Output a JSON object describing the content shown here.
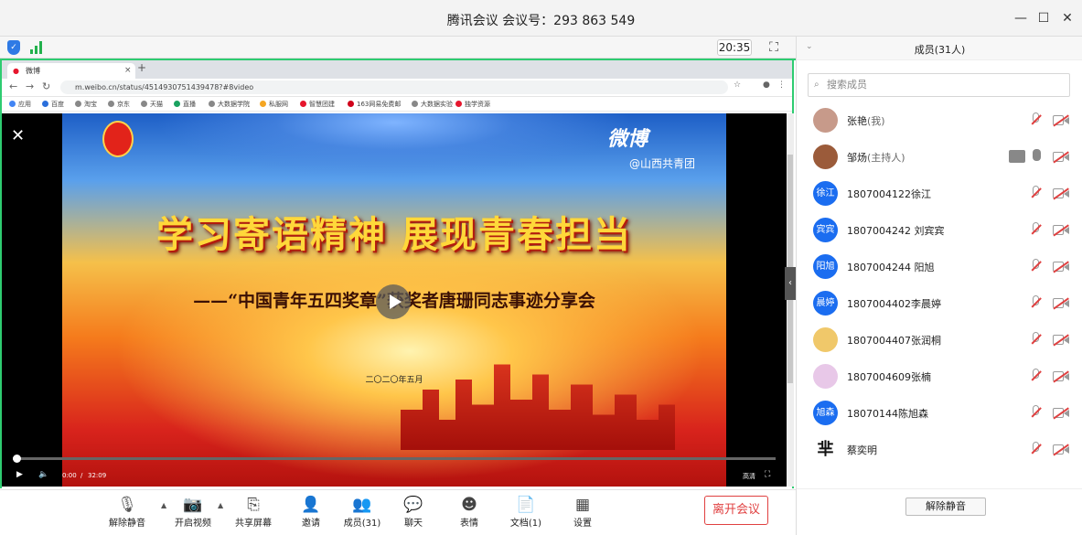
{
  "window": {
    "title": "腾讯会议 会议号：293 863 549",
    "minimize": "—",
    "maximize": "☐",
    "close": "✕"
  },
  "topbar": {
    "clock": "20:35",
    "fullscreen_icon": "fullscreen-icon"
  },
  "browser": {
    "tab_title": "微博",
    "tab_close": "×",
    "new_tab": "+",
    "url": "m.weibo.cn/status/4514930751439478?#8video",
    "bookmarks": [
      "应用",
      "百度",
      "淘宝",
      "京东",
      "天猫",
      "直播",
      "大数据学院",
      "私服网",
      "智慧团建",
      "163网易免费邮",
      "大数据实验",
      "独学资源"
    ]
  },
  "video": {
    "poster_title": "学习寄语精神  展现青春担当",
    "poster_subtitle": "——“中国青年五四奖章”获奖者唐珊同志事迹分享会",
    "poster_date": "二〇二〇年五月",
    "weibo_logo": "微博",
    "weibo_account": "@山西共青团",
    "current_time": "0:00",
    "duration": "32:09",
    "quality": "高清",
    "progress": 0.0
  },
  "toolbar": {
    "items": [
      {
        "label": "解除静音",
        "icon": "mic-muted-icon"
      },
      {
        "label": "开启视频",
        "icon": "camera-off-icon"
      },
      {
        "label": "共享屏幕",
        "icon": "share-screen-icon"
      },
      {
        "label": "邀请",
        "icon": "invite-icon"
      },
      {
        "label": "成员(31)",
        "icon": "members-icon"
      },
      {
        "label": "聊天",
        "icon": "chat-icon"
      },
      {
        "label": "表情",
        "icon": "emoji-icon"
      },
      {
        "label": "文档(1)",
        "icon": "document-icon"
      },
      {
        "label": "设置",
        "icon": "settings-icon"
      }
    ],
    "leave_label": "离开会议"
  },
  "panel": {
    "title": "成员(31人)",
    "search_placeholder": "搜索成员",
    "members": [
      {
        "name": "张艳",
        "role": "(我)",
        "avatar": ""
      },
      {
        "name": "邹炀",
        "role": "(主持人)",
        "avatar": ""
      },
      {
        "name": "1807004122徐江",
        "role": "",
        "avatar": "徐江"
      },
      {
        "name": "1807004242  刘宾宾",
        "role": "",
        "avatar": "宾宾"
      },
      {
        "name": "1807004244 阳旭",
        "role": "",
        "avatar": "阳旭"
      },
      {
        "name": "1807004402李晨婷",
        "role": "",
        "avatar": "晨婷"
      },
      {
        "name": "1807004407张润桐",
        "role": "",
        "avatar": ""
      },
      {
        "name": "1807004609张楠",
        "role": "",
        "avatar": ""
      },
      {
        "name": "18070144陈旭森",
        "role": "",
        "avatar": "旭森"
      },
      {
        "name": "蔡奕明",
        "role": "",
        "avatar": "芈"
      }
    ],
    "unmute_all": "解除静音"
  }
}
